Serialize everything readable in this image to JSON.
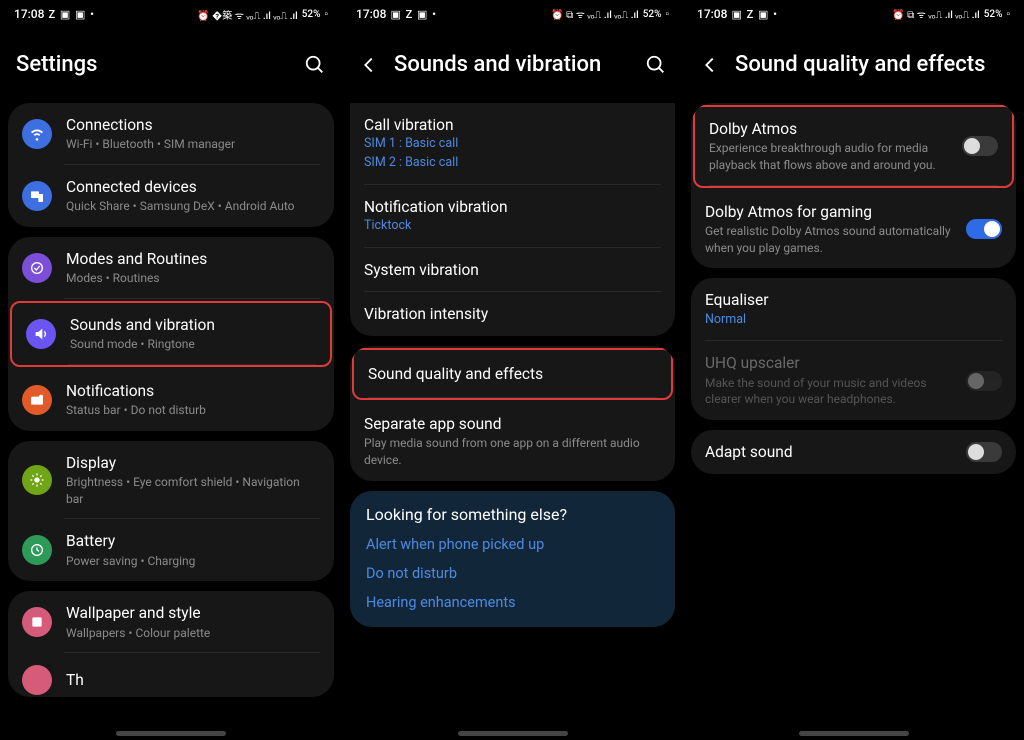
{
  "status": {
    "time": "17:08",
    "battery": "52%"
  },
  "s1": {
    "title": "Settings",
    "items": [
      {
        "title": "Connections",
        "sub": "Wi-Fi  •  Bluetooth  •  SIM manager",
        "iconColor": "#3d6fe0",
        "sep": true
      },
      {
        "title": "Connected devices",
        "sub": "Quick Share  •  Samsung DeX  •  Android Auto",
        "iconColor": "#3d6fe0"
      },
      {
        "title": "Modes and Routines",
        "sub": "Modes  •  Routines",
        "iconColor": "#7b4fd8",
        "sep": true
      },
      {
        "title": "Sounds and vibration",
        "sub": "Sound mode  •  Ringtone",
        "iconColor": "#6a55f0",
        "highlight": true,
        "sep": true
      },
      {
        "title": "Notifications",
        "sub": "Status bar  •  Do not disturb",
        "iconColor": "#e05a2a"
      },
      {
        "title": "Display",
        "sub": "Brightness  •  Eye comfort shield  •  Navigation bar",
        "iconColor": "#6fa516",
        "sep": true
      },
      {
        "title": "Battery",
        "sub": "Power saving  •  Charging",
        "iconColor": "#2d9a5a"
      },
      {
        "title": "Wallpaper and style",
        "sub": "Wallpapers  •  Colour palette",
        "iconColor": "#d65a7a",
        "sep": true
      },
      {
        "title": "Th",
        "sub": "",
        "iconColor": "#d65a7a"
      }
    ]
  },
  "s2": {
    "title": "Sounds and vibration",
    "g1": [
      {
        "title": "Call vibration",
        "links": [
          "SIM 1 : Basic call",
          "SIM 2 : Basic call"
        ]
      },
      {
        "title": "Notification vibration",
        "links": [
          "Ticktock"
        ]
      },
      {
        "title": "System vibration"
      },
      {
        "title": "Vibration intensity"
      }
    ],
    "g2": [
      {
        "title": "Sound quality and effects",
        "highlight": true
      },
      {
        "title": "Separate app sound",
        "sub": "Play media sound from one app on a different audio device."
      }
    ],
    "suggest": {
      "title": "Looking for something else?",
      "links": [
        "Alert when phone picked up",
        "Do not disturb",
        "Hearing enhancements"
      ]
    }
  },
  "s3": {
    "title": "Sound quality and effects",
    "g1": [
      {
        "title": "Dolby Atmos",
        "sub": "Experience breakthrough audio for media playback that flows above and around you.",
        "toggle": false,
        "highlight": true
      },
      {
        "title": "Dolby Atmos for gaming",
        "sub": "Get realistic Dolby Atmos sound automatically when you play games.",
        "toggle": true
      }
    ],
    "g2": [
      {
        "title": "Equaliser",
        "link": "Normal",
        "sep": true
      },
      {
        "title": "UHQ upscaler",
        "sub": "Make the sound of your music and videos clearer when you wear headphones.",
        "toggle": false,
        "disabled": true
      }
    ],
    "g3": [
      {
        "title": "Adapt sound",
        "toggle": false
      }
    ]
  }
}
